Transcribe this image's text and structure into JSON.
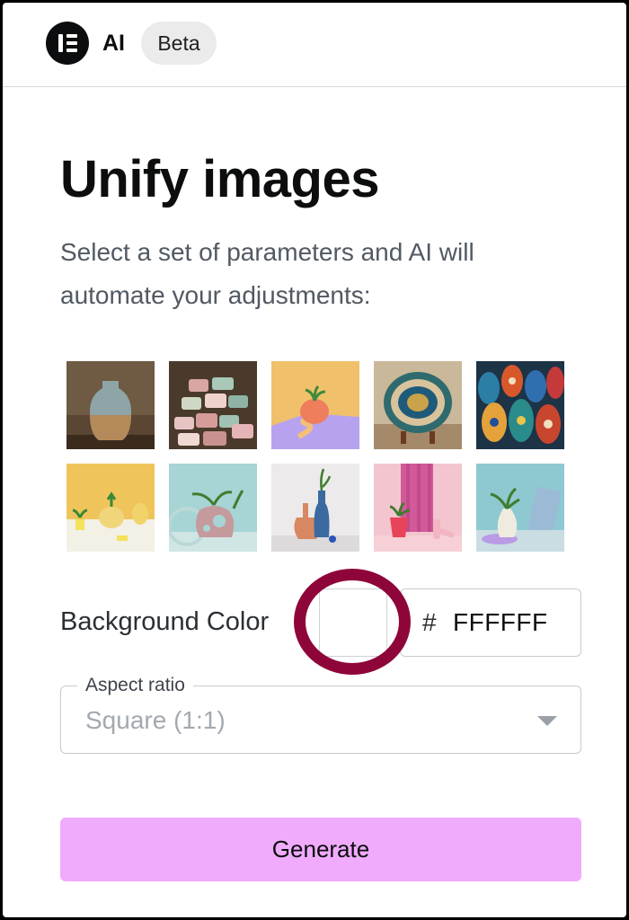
{
  "header": {
    "ai_label": "AI",
    "beta_label": "Beta",
    "logo_icon": "elementor-logo-icon"
  },
  "main": {
    "title": "Unify images",
    "subtitle": "Select a set of parameters and AI will automate your adjustments:"
  },
  "images": [
    {
      "name": "blue-gradient-vase-thumbnail"
    },
    {
      "name": "stacked-pastel-cups-thumbnail"
    },
    {
      "name": "orange-pot-on-purple-thumbnail"
    },
    {
      "name": "mosaic-plate-thumbnail"
    },
    {
      "name": "painted-vases-collection-thumbnail"
    },
    {
      "name": "yellow-vases-with-plants-thumbnail"
    },
    {
      "name": "pink-ring-vase-thumbnail"
    },
    {
      "name": "terracotta-and-blue-vases-thumbnail"
    },
    {
      "name": "pink-arch-plant-pot-thumbnail"
    },
    {
      "name": "white-vase-on-blue-thumbnail"
    }
  ],
  "background_color": {
    "label": "Background Color",
    "hash": "#",
    "value": "FFFFFF",
    "swatch_color": "#FFFFFF",
    "highlight_color": "#8E0639"
  },
  "aspect_ratio": {
    "legend": "Aspect ratio",
    "selected": "Square (1:1)"
  },
  "actions": {
    "generate_label": "Generate",
    "generate_color": "#F0ABFC"
  }
}
